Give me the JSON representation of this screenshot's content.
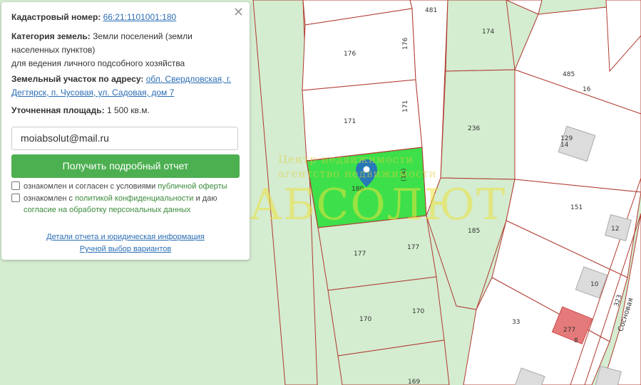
{
  "panel": {
    "cadastral_label": "Кадастровый номер:",
    "cadastral_number": "66:21:1101001:180",
    "category_label": "Категория земель:",
    "category_line1": "Земли поселений (земли",
    "category_line2": "населенных пунктов)",
    "category_line3": "для ведения личного подсобного хозяйства",
    "address_label": "Земельный участок по адресу:",
    "address_line1": "обл. Свердловская, г.",
    "address_line2": "Дегтярск, п. Чусовая, ул. Садовая, дом 7",
    "area_label": "Уточненная площадь:",
    "area_value": "1 500 кв.м.",
    "email_value": "moiabsolut@mail.ru",
    "report_button": "Получить подробный отчет",
    "consent1_text": "ознакомлен и согласен с условиями",
    "consent1_link": "публичной оферты",
    "consent2_text": "ознакомлен с",
    "consent2_link": "политикой конфиденциальности",
    "consent2_text_after": "и даю",
    "consent2_link2": "согласие на обработку персональных данных",
    "details_link": "Детали отчета и юридическая информация",
    "manual_link": "Ручной выбор вариантов"
  },
  "watermark": {
    "brand": "АБСОЛЮТ",
    "subtitle_line1": "Центр недвижимости",
    "subtitle_line2": "агентство недвижимости"
  },
  "map": {
    "selected_parcel": "180",
    "parcel_labels": [
      "481",
      "176",
      "176",
      "174",
      "485",
      "16",
      "171",
      "171",
      "236",
      "129",
      "14",
      "151",
      "12",
      "185",
      "177",
      "177",
      "10",
      "170",
      "170",
      "33",
      "277",
      "8",
      "323",
      "169",
      "(14)"
    ],
    "street_name": "Сосновая",
    "colors": {
      "background": "#d4ecd0",
      "parcel_fill": "#ffffff",
      "parcel_border": "#b03a30",
      "selected_fill": "#3de04a",
      "building_fill": "#dcdcdc",
      "highlight_building": "#e57a7a",
      "link": "#2a6db5",
      "button": "#4caf50"
    }
  }
}
